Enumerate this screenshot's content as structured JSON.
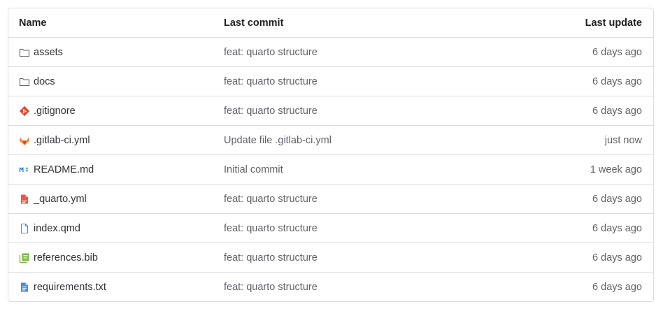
{
  "table": {
    "headers": {
      "name": "Name",
      "last_commit": "Last commit",
      "last_update": "Last update"
    },
    "rows": [
      {
        "name": "assets",
        "icon": "folder-icon",
        "commit": "feat: quarto structure",
        "updated": "6 days ago"
      },
      {
        "name": "docs",
        "icon": "folder-icon",
        "commit": "feat: quarto structure",
        "updated": "6 days ago"
      },
      {
        "name": ".gitignore",
        "icon": "git-icon",
        "commit": "feat: quarto structure",
        "updated": "6 days ago"
      },
      {
        "name": ".gitlab-ci.yml",
        "icon": "gitlab-icon",
        "commit": "Update file .gitlab-ci.yml",
        "updated": "just now"
      },
      {
        "name": "README.md",
        "icon": "markdown-icon",
        "commit": "Initial commit",
        "updated": "1 week ago"
      },
      {
        "name": "_quarto.yml",
        "icon": "yaml-file-icon",
        "commit": "feat: quarto structure",
        "updated": "6 days ago"
      },
      {
        "name": "index.qmd",
        "icon": "file-icon",
        "commit": "feat: quarto structure",
        "updated": "6 days ago"
      },
      {
        "name": "references.bib",
        "icon": "bibliography-icon",
        "commit": "feat: quarto structure",
        "updated": "6 days ago"
      },
      {
        "name": "requirements.txt",
        "icon": "text-file-icon",
        "commit": "feat: quarto structure",
        "updated": "6 days ago"
      }
    ]
  },
  "colors": {
    "border": "#dcdcde",
    "text": "#333238",
    "muted": "#626168",
    "git_orange": "#e24329",
    "gitlab_orange": "#fc6d26",
    "markdown_blue": "#1f78d1",
    "yaml_red": "#ec5941",
    "file_blue": "#428fdc",
    "bib_green": "#7cb342"
  }
}
